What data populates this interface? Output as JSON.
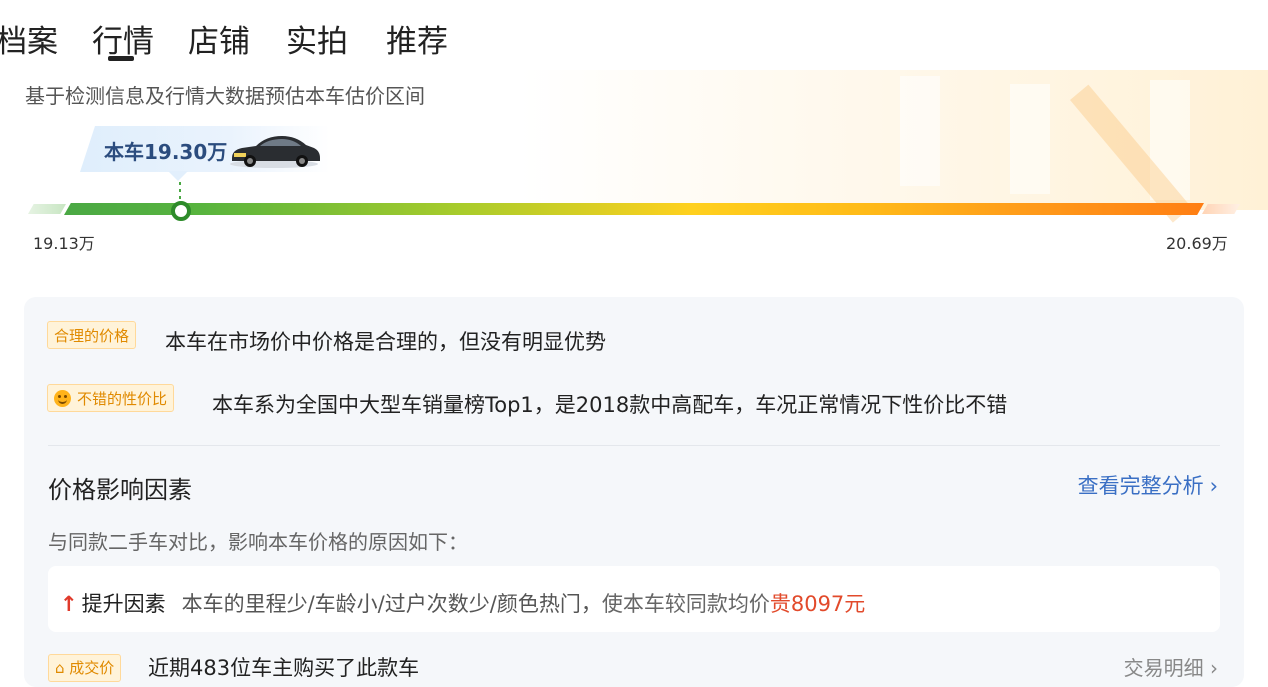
{
  "tabs": [
    {
      "label": "档案"
    },
    {
      "label": "行情"
    },
    {
      "label": "店铺"
    },
    {
      "label": "实拍"
    },
    {
      "label": "推荐"
    }
  ],
  "active_tab": "行情",
  "estimate": {
    "subtitle": "基于检测信息及行情大数据预估本车估价区间",
    "car_price_label": "本车19.30万",
    "min_label": "19.13万",
    "max_label": "20.69万",
    "marker_position_fraction": 0.11
  },
  "assessment": {
    "tag1": "合理的价格",
    "line1": "本车在市场价中价格是合理的，但没有明显优势",
    "tag2": "不错的性价比",
    "line2": "本车系为全国中大型车销量榜Top1，是2018款中高配车，车况正常情况下性价比不错"
  },
  "factors": {
    "title": "价格影响因素",
    "link": "查看完整分析",
    "desc": "与同款二手车对比，影响本车价格的原因如下：",
    "up_arrow": "↑",
    "up_label": "提升因素",
    "up_items": "本车的里程少/车龄小/过户次数少/颜色热门，",
    "up_result": "使本车较同款均价",
    "up_amount": "贵8097元"
  },
  "deal": {
    "tag": "成交价",
    "text": "近期483位车主购买了此款车",
    "link": "交易明细"
  },
  "colors": {
    "accent_blue": "#3a6fc4",
    "tag_orange": "#e08a00",
    "price_red": "#e24a2b",
    "bar_start_green": "#4aa844",
    "bar_end_orange": "#ff7e13"
  }
}
